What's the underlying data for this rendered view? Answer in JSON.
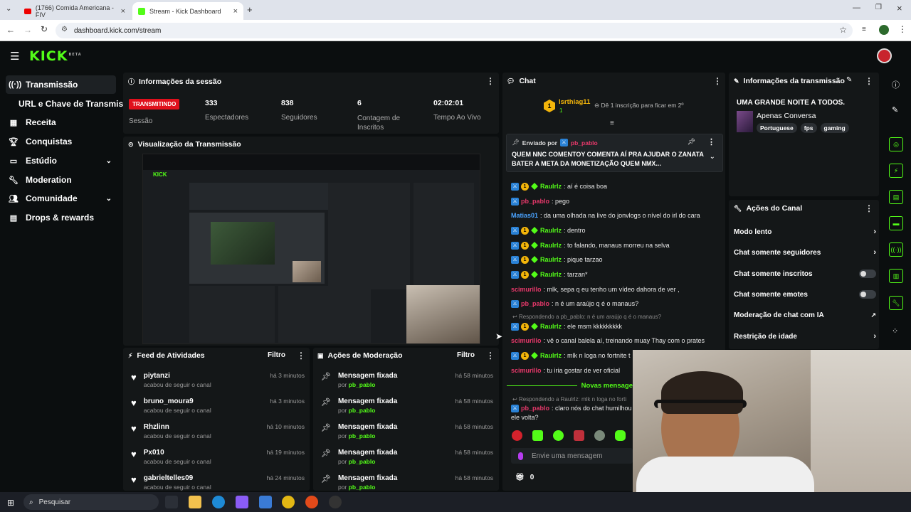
{
  "browser": {
    "tab1": "(1766) Comida Americana - FIV",
    "tab2": "Stream - Kick Dashboard",
    "url": "dashboard.kick.com/stream"
  },
  "sidebar": {
    "items": [
      {
        "label": "Transmissão",
        "icon": "broadcast-icon"
      },
      {
        "label": "URL e Chave de Transmissão",
        "icon": ""
      },
      {
        "label": "Receita",
        "icon": "revenue-icon"
      },
      {
        "label": "Conquistas",
        "icon": "trophy-icon"
      },
      {
        "label": "Estúdio",
        "icon": "studio-icon"
      },
      {
        "label": "Moderation",
        "icon": "wrench-icon"
      },
      {
        "label": "Comunidade",
        "icon": "community-icon"
      },
      {
        "label": "Drops & rewards",
        "icon": "drops-icon"
      }
    ]
  },
  "session": {
    "title": "Informações da sessão",
    "live_badge": "TRANSMITINDO",
    "session_label": "Sessão",
    "viewers": "333",
    "viewers_label": "Espectadores",
    "followers": "838",
    "followers_label": "Seguidores",
    "subs": "6",
    "subs_label": "Contagem de Inscritos",
    "time": "02:02:01",
    "time_label": "Tempo Ao Vivo"
  },
  "preview": {
    "title": "Visualização da Transmissão"
  },
  "activity": {
    "title": "Feed de Atividades",
    "filter": "Filtro",
    "rows": [
      {
        "name": "piytanzi",
        "sub": "acabou de seguir o canal",
        "time": "há 3 minutos"
      },
      {
        "name": "bruno_moura9",
        "sub": "acabou de seguir o canal",
        "time": "há 3 minutos"
      },
      {
        "name": "Rhzlinn",
        "sub": "acabou de seguir o canal",
        "time": "há 10 minutos"
      },
      {
        "name": "Px010",
        "sub": "acabou de seguir o canal",
        "time": "há 19 minutos"
      },
      {
        "name": "gabrieltelles09",
        "sub": "acabou de seguir o canal",
        "time": "há 24 minutos"
      }
    ]
  },
  "moderation": {
    "title": "Ações de Moderação",
    "filter": "Filtro",
    "rows": [
      {
        "name": "Mensagem fixada",
        "by": "por",
        "user": "pb_pablo",
        "time": "há 58 minutos"
      },
      {
        "name": "Mensagem fixada",
        "by": "por",
        "user": "pb_pablo",
        "time": "há 58 minutos"
      },
      {
        "name": "Mensagem fixada",
        "by": "por",
        "user": "pb_pablo",
        "time": "há 58 minutos"
      },
      {
        "name": "Mensagem fixada",
        "by": "por",
        "user": "pb_pablo",
        "time": "há 58 minutos"
      },
      {
        "name": "Mensagem fixada",
        "by": "por",
        "user": "pb_pablo",
        "time": "há 58 minutos"
      }
    ]
  },
  "chat": {
    "title": "Chat",
    "top_user": "lsrthiag11",
    "top_count": "1",
    "sub_goal": "Dê 1 inscrição para ficar em 2º",
    "pinned_by_label": "Enviado por",
    "pinned_user": "pb_pablo",
    "pinned_text": "QUEM NNC COMENTOY COMENTA AÍ PRA AJUDAR O ZANATA BATER A META DA MONETIZAÇÃO QUEM NMX...",
    "messages": [
      {
        "user": "Raulrlz",
        "text": ": aí é coisa boa"
      },
      {
        "user": "pb_pablo",
        "text": ": pego"
      },
      {
        "user": "Matias01",
        "text": ": da uma olhada na live do jonvlogs o nível do irl do cara"
      },
      {
        "user": "Raulrlz",
        "text": ": dentro"
      },
      {
        "user": "Raulrlz",
        "text": ": to falando, manaus morreu na selva"
      },
      {
        "user": "Raulrlz",
        "text": ": pique tarzao"
      },
      {
        "user": "Raulrlz",
        "text": ": tarzan*"
      },
      {
        "user": "scimurillo",
        "text": ": mlk, sepa q eu tenho um vídeo dahora de ver ,"
      },
      {
        "user": "pb_pablo",
        "text": ": n é um araújo q é o manaus?"
      },
      {
        "user": "Raulrlz",
        "text": ": ele msm kkkkkkkkk"
      },
      {
        "user": "scimurillo",
        "text": ": vê o canal balela aí, treinando muay Thay com o prates"
      },
      {
        "user": "Raulrlz",
        "text": ": mlk n loga no fortnite t"
      },
      {
        "user": "scimurillo",
        "text": ": tu iria gostar de ver oficial"
      },
      {
        "user": "pb_pablo",
        "text": ": claro nós do chat humilhou"
      }
    ],
    "reply1": "Respondendo a pb_pablo: n é um araújo q é o manaus?",
    "reply2": "Respondendo a Raulrlz: mlk n loga no forti",
    "new_messages": "Novas mensage",
    "last_line2": "ele volta?",
    "input_placeholder": "Envie uma mensagem",
    "points": "0"
  },
  "stream_info": {
    "title": "Informações da transmissão",
    "stream_title": "UMA GRANDE NOITE A TODOS.",
    "category": "Apenas Conversa",
    "tags": [
      "Portuguese",
      "fps",
      "gaming"
    ]
  },
  "channel_actions": {
    "title": "Ações do Canal",
    "items": [
      {
        "label": "Modo lento",
        "control": "arrow"
      },
      {
        "label": "Chat somente seguidores",
        "control": "arrow"
      },
      {
        "label": "Chat somente inscritos",
        "control": "toggle"
      },
      {
        "label": "Chat somente emotes",
        "control": "toggle"
      },
      {
        "label": "Moderação de chat com IA",
        "control": "external"
      },
      {
        "label": "Restrição de idade",
        "control": "arrow"
      }
    ]
  },
  "taskbar": {
    "search": "Pesquisar"
  },
  "colors": {
    "brand": "#53fc18",
    "live": "#e0101c",
    "panel": "#141718",
    "bg": "#0b0e0f"
  }
}
